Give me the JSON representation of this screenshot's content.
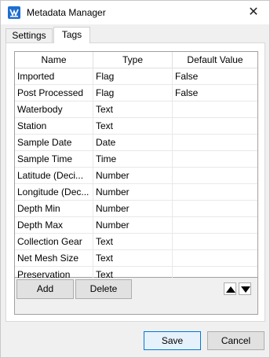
{
  "window": {
    "title": "Metadata Manager",
    "close_glyph": "✕"
  },
  "tabs": [
    {
      "label": "Settings",
      "selected": false
    },
    {
      "label": "Tags",
      "selected": true
    }
  ],
  "grid": {
    "columns": [
      "Name",
      "Type",
      "Default Value"
    ],
    "rows": [
      {
        "name": "Imported",
        "type": "Flag",
        "default": "False"
      },
      {
        "name": "Post Processed",
        "type": "Flag",
        "default": "False"
      },
      {
        "name": "Waterbody",
        "type": "Text",
        "default": ""
      },
      {
        "name": "Station",
        "type": "Text",
        "default": ""
      },
      {
        "name": "Sample Date",
        "type": "Date",
        "default": ""
      },
      {
        "name": "Sample Time",
        "type": "Time",
        "default": ""
      },
      {
        "name": "Latitude (Deci...",
        "type": "Number",
        "default": ""
      },
      {
        "name": "Longitude (Dec...",
        "type": "Number",
        "default": ""
      },
      {
        "name": "Depth Min",
        "type": "Number",
        "default": ""
      },
      {
        "name": "Depth Max",
        "type": "Number",
        "default": ""
      },
      {
        "name": "Collection Gear",
        "type": "Text",
        "default": ""
      },
      {
        "name": "Net Mesh Size",
        "type": "Text",
        "default": ""
      },
      {
        "name": "Preservation",
        "type": "Text",
        "default": ""
      }
    ]
  },
  "toolbar": {
    "add_label": "Add",
    "delete_label": "Delete",
    "move_up_icon": "triangle-up-icon",
    "move_down_icon": "triangle-down-icon"
  },
  "dialog": {
    "save_label": "Save",
    "cancel_label": "Cancel"
  },
  "colors": {
    "accent": "#0078d7",
    "app_icon": "#1f6fd1"
  }
}
